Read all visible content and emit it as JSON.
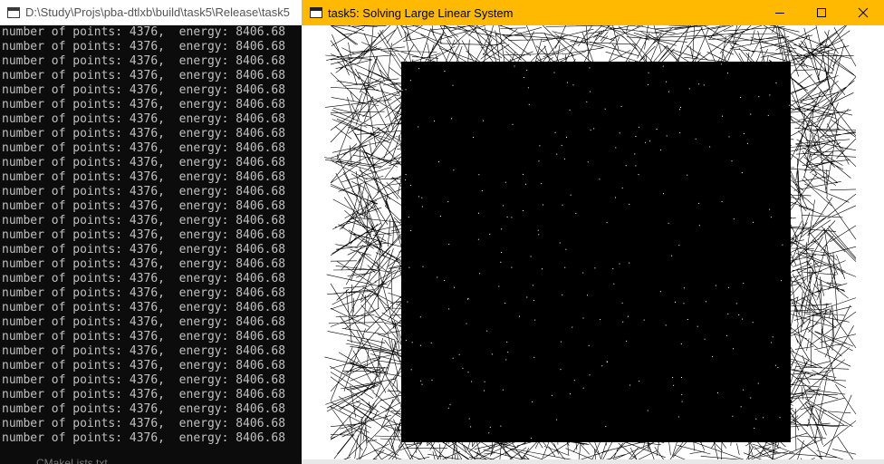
{
  "console": {
    "title": "D:\\Study\\Projs\\pba-dtlxb\\build\\task5\\Release\\task5",
    "lines": [
      "number of points: 4376,  energy: 8406.68",
      "number of points: 4376,  energy: 8406.68",
      "number of points: 4376,  energy: 8406.68",
      "number of points: 4376,  energy: 8406.68",
      "number of points: 4376,  energy: 8406.68",
      "number of points: 4376,  energy: 8406.68",
      "number of points: 4376,  energy: 8406.68",
      "number of points: 4376,  energy: 8406.68",
      "number of points: 4376,  energy: 8406.68",
      "number of points: 4376,  energy: 8406.68",
      "number of points: 4376,  energy: 8406.68",
      "number of points: 4376,  energy: 8406.68",
      "number of points: 4376,  energy: 8406.68",
      "number of points: 4376,  energy: 8406.68",
      "number of points: 4376,  energy: 8406.68",
      "number of points: 4376,  energy: 8406.68",
      "number of points: 4376,  energy: 8406.68",
      "number of points: 4376,  energy: 8406.68",
      "number of points: 4376,  energy: 8406.68",
      "number of points: 4376,  energy: 8406.68",
      "number of points: 4376,  energy: 8406.68",
      "number of points: 4376,  energy: 8406.68",
      "number of points: 4376,  energy: 8406.68",
      "number of points: 4376,  energy: 8406.68",
      "number of points: 4376,  energy: 8406.68",
      "number of points: 4376,  energy: 8406.68",
      "number of points: 4376,  energy: 8406.68",
      "number of points: 4376,  energy: 8406.68",
      "number of points: 4376,  energy: 8406.68"
    ]
  },
  "app": {
    "title": "task5: Solving Large Linear System",
    "accent_color": "#ffb900",
    "controls": {
      "minimize_icon": "minimize-icon",
      "maximize_icon": "maximize-icon",
      "close_icon": "close-icon"
    },
    "canvas": {
      "content": "triangle-mesh",
      "line_color": "#000000",
      "background": "#ffffff"
    }
  },
  "background_peek": {
    "label": "CMakeLists.txt"
  }
}
